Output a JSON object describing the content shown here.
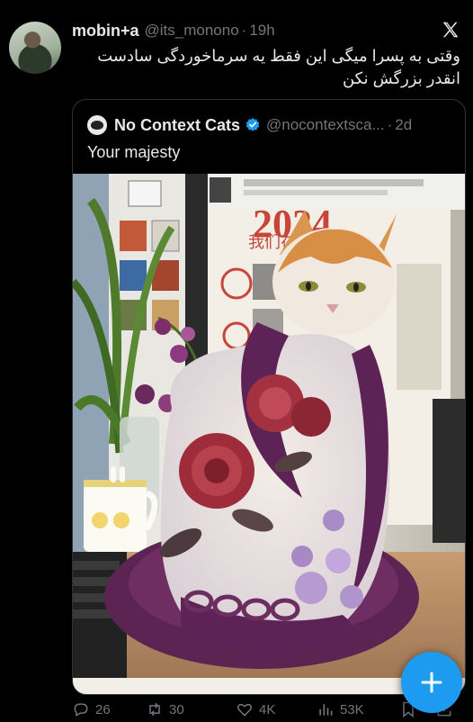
{
  "tweet": {
    "author_name": "mobin+a",
    "author_handle": "@its_monono",
    "separator": "·",
    "time": "19h",
    "text": "وقتی به پسرا میگی این فقط یه سرماخوردگی سادست انقدر بزرگش نکن"
  },
  "quote": {
    "author_name": "No Context Cats",
    "author_handle": "@nocontextsca...",
    "separator": "·",
    "time": "2d",
    "text": "Your majesty",
    "poster_text": "2024",
    "poster_subtitle": "我们在桑拿年会"
  },
  "actions": {
    "replies": "26",
    "reposts": "30",
    "likes": "4K",
    "views": "53K"
  },
  "icons": {
    "logo": "x-logo-icon",
    "verified": "verified-badge-icon",
    "reply": "reply-icon",
    "repost": "repost-icon",
    "like": "heart-icon",
    "views": "views-icon",
    "bookmark": "bookmark-icon",
    "share": "share-icon",
    "compose": "plus-icon"
  },
  "colors": {
    "background": "#000000",
    "text": "#e7e9ea",
    "muted": "#71767b",
    "accent": "#1d9bf0",
    "border": "#2f3336"
  }
}
